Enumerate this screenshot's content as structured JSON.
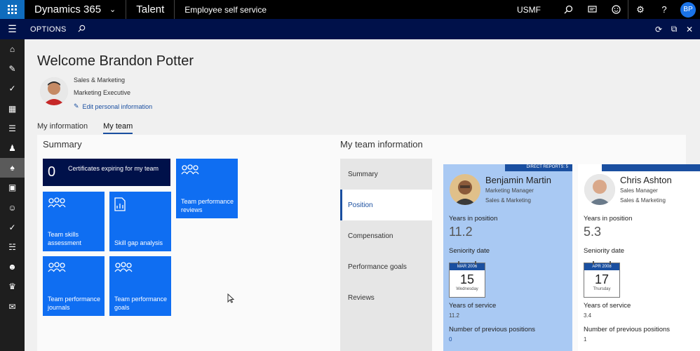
{
  "topbar": {
    "product": "Dynamics 365",
    "app": "Talent",
    "module": "Employee self service",
    "company": "USMF",
    "user_initials": "BP"
  },
  "optbar": {
    "label": "OPTIONS"
  },
  "welcome": {
    "title": "Welcome Brandon Potter",
    "department": "Sales & Marketing",
    "job": "Marketing Executive",
    "edit_link": "Edit personal information"
  },
  "tabs": [
    "My information",
    "My team"
  ],
  "summary": {
    "title": "Summary",
    "cert_count": "0",
    "cert_label": "Certificates expiring for my team",
    "tiles": [
      "Team performance reviews",
      "Team skills assessment",
      "Skill gap analysis",
      "Team performance journals",
      "Team performance goals"
    ]
  },
  "team": {
    "title": "My team information",
    "menu": [
      "Summary",
      "Position",
      "Compensation",
      "Performance goals",
      "Reviews"
    ],
    "cards": [
      {
        "badge": "DIRECT REPORTS: 5",
        "name": "Benjamin Martin",
        "job": "Marketing Manager",
        "dept": "Sales & Marketing",
        "years_position_label": "Years in position",
        "years_position": "11.2",
        "seniority_label": "Seniority date",
        "cal_month": "MAR 2006",
        "cal_day": "15",
        "cal_weekday": "Wednesday",
        "service_label": "Years of service",
        "service": "11.2",
        "prev_label": "Number of previous positions",
        "prev": "0"
      },
      {
        "name": "Chris Ashton",
        "job": "Sales Manager",
        "dept": "Sales & Marketing",
        "years_position_label": "Years in position",
        "years_position": "5.3",
        "seniority_label": "Seniority date",
        "cal_month": "APR 2008",
        "cal_day": "17",
        "cal_weekday": "Thursday",
        "service_label": "Years of service",
        "service": "3.4",
        "prev_label": "Number of previous positions",
        "prev": "1"
      }
    ]
  },
  "colors": {
    "accent": "#0f6ef2",
    "navy": "#00114a",
    "highlight": "#a9c9f3"
  }
}
